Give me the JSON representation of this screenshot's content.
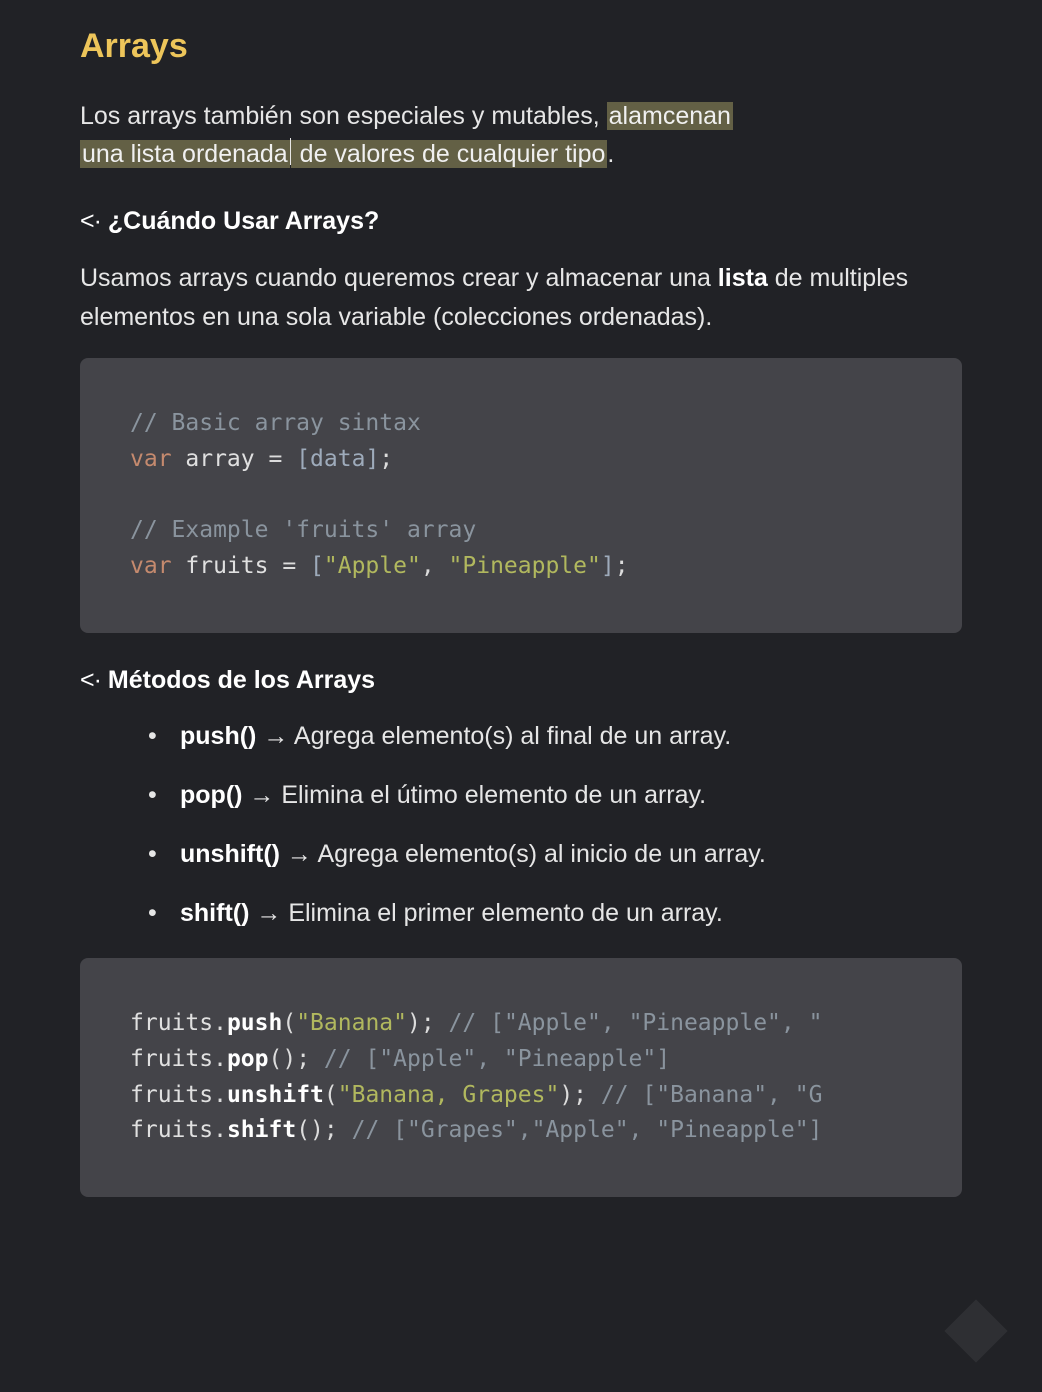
{
  "title": "Arrays",
  "intro": {
    "before": "Los arrays también son especiales y mutables, ",
    "hl1": "alamcenan ",
    "hl2a": "una lista ordenada",
    "hl2b": " de valores de cualquier tipo",
    "after": "."
  },
  "section1": {
    "prefix": "<·",
    "title": " ¿Cuándo Usar Arrays?",
    "para_a": "Usamos arrays cuando queremos crear y almacenar una ",
    "para_bold": "lista",
    "para_b": " de multiples elementos en una sola variable (colecciones ordenadas)."
  },
  "code1": {
    "c1": "// Basic array sintax",
    "kw1": "var",
    "id1": " array ",
    "eq": "= ",
    "lbr": "[",
    "data": "data",
    "rbr": "]",
    "semi": ";",
    "c2": "// Example 'fruits' array",
    "kw2": "var",
    "id2": " fruits ",
    "s1": "\"Apple\"",
    "comma": ", ",
    "s2": "\"Pineapple\""
  },
  "section2": {
    "prefix": "<·",
    "title": " Métodos de los Arrays"
  },
  "methods": [
    {
      "name": "push()",
      "arrow": " → ",
      "desc": "Agrega elemento(s) al final de un array."
    },
    {
      "name": "pop()",
      "arrow": " → ",
      "desc": "Elimina el útimo elemento de un array."
    },
    {
      "name": "unshift()",
      "arrow": " → ",
      "desc": "Agrega elemento(s) al inicio de un array."
    },
    {
      "name": "shift()",
      "arrow": " → ",
      "desc": "Elimina el primer elemento de un array."
    }
  ],
  "code2": {
    "l1_obj": "fruits",
    "l1_dot": ".",
    "l1_fn": "push",
    "l1_p1": "(",
    "l1_arg": "\"Banana\"",
    "l1_p2": ")",
    "l1_semi": ";",
    "l1_cm": " // [\"Apple\", \"Pineapple\", \"",
    "l2_obj": "fruits",
    "l2_fn": "pop",
    "l2_call": "();",
    "l2_cm": " // [\"Apple\", \"Pineapple\"]",
    "l3_obj": "fruits",
    "l3_fn": "unshift",
    "l3_p1": "(",
    "l3_arg": "\"Banana, Grapes\"",
    "l3_p2": ")",
    "l3_semi": ";",
    "l3_cm": " // [\"Banana\", \"G",
    "l4_obj": "fruits",
    "l4_fn": "shift",
    "l4_call": "();",
    "l4_cm": " // [\"Grapes\",\"Apple\", \"Pineapple\"]"
  }
}
